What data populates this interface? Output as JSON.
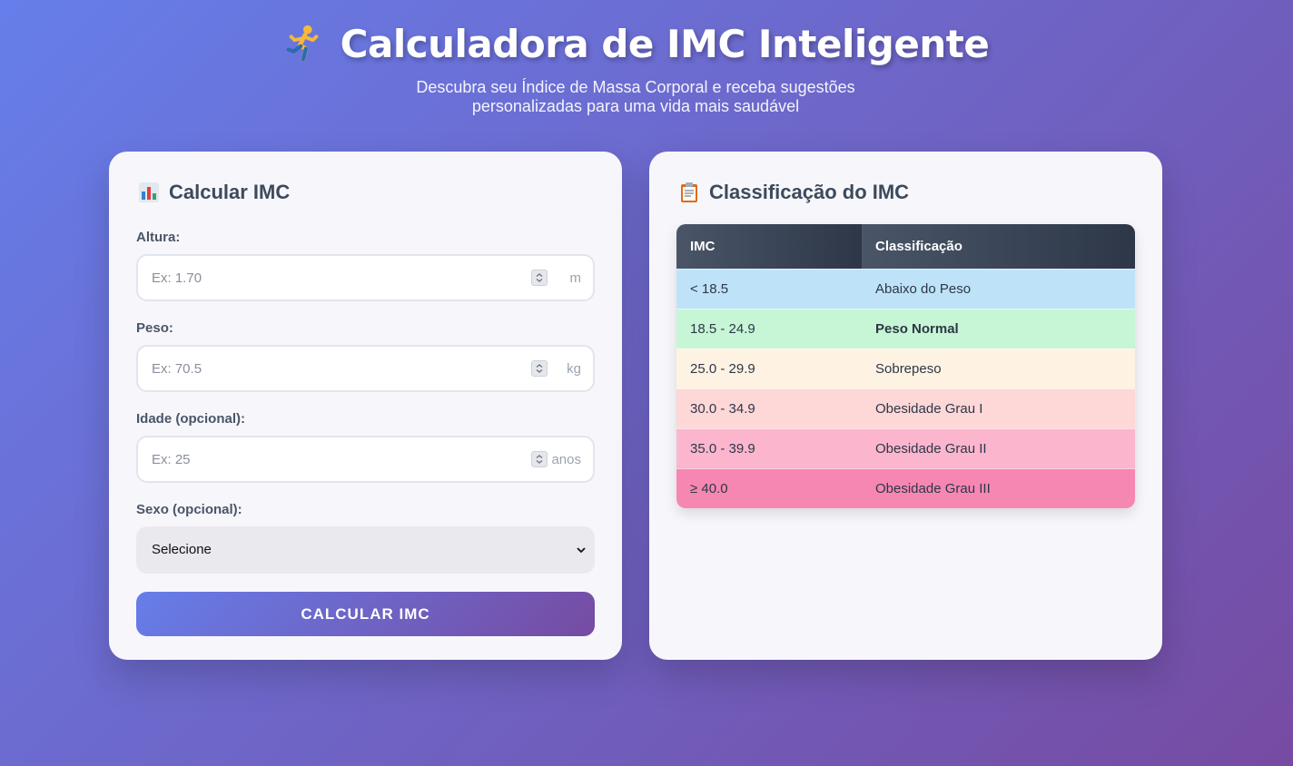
{
  "header": {
    "icon": "running-person-icon",
    "title": "Calculadora de IMC Inteligente",
    "subtitle": "Descubra seu Índice de Massa Corporal e receba sugestões personalizadas para uma vida mais saudável"
  },
  "calculator": {
    "title": "Calcular IMC",
    "icon": "bar-chart-icon",
    "height": {
      "label": "Altura:",
      "placeholder": "Ex: 1.70",
      "unit": "m"
    },
    "weight": {
      "label": "Peso:",
      "placeholder": "Ex: 70.5",
      "unit": "kg"
    },
    "age": {
      "label": "Idade (opcional):",
      "placeholder": "Ex: 25",
      "unit": "anos"
    },
    "sex": {
      "label": "Sexo (opcional):",
      "selected": "Selecione"
    },
    "submit_label": "CALCULAR IMC"
  },
  "classification": {
    "title": "Classificação do IMC",
    "icon": "clipboard-icon",
    "columns": [
      "IMC",
      "Classificação"
    ],
    "rows": [
      {
        "range": "< 18.5",
        "label": "Abaixo do Peso",
        "color": "#bee3f8"
      },
      {
        "range": "18.5 - 24.9",
        "label": "Peso Normal",
        "color": "#c6f6d5"
      },
      {
        "range": "25.0 - 29.9",
        "label": "Sobrepeso",
        "color": "#fef3e2"
      },
      {
        "range": "30.0 - 34.9",
        "label": "Obesidade Grau I",
        "color": "#fed7d7"
      },
      {
        "range": "35.0 - 39.9",
        "label": "Obesidade Grau II",
        "color": "#fbb6ce"
      },
      {
        "range": "≥ 40.0",
        "label": "Obesidade Grau III",
        "color": "#f687b3"
      }
    ]
  },
  "colors": {
    "background_start": "#667eea",
    "background_end": "#764ba2",
    "table_header": "#2d3748"
  }
}
